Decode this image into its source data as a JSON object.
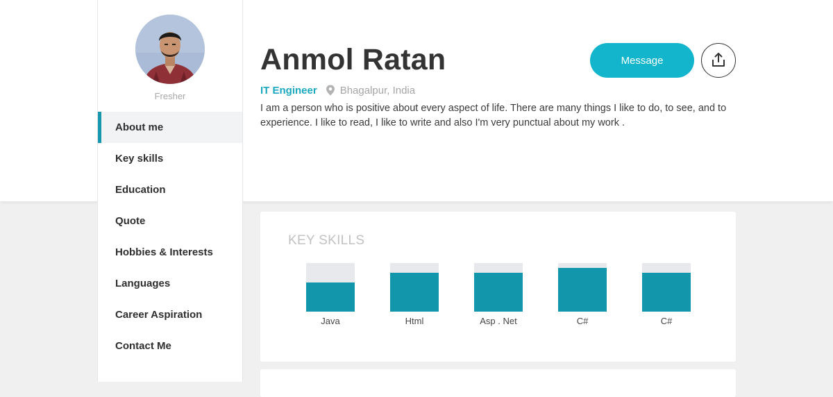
{
  "profile": {
    "role": "Fresher",
    "name": "Anmol Ratan",
    "job_title": "IT Engineer",
    "location": "Bhagalpur, India",
    "bio": "I am a person who is positive about every aspect of life. There are many things I like to do, to see, and to experience. I like to read, I like to write and also I'm very punctual about my work ."
  },
  "actions": {
    "message_label": "Message",
    "share_icon": "share-upload-icon"
  },
  "sidebar": {
    "active_index": 0,
    "items": [
      {
        "label": "About me"
      },
      {
        "label": "Key skills"
      },
      {
        "label": "Education"
      },
      {
        "label": "Quote"
      },
      {
        "label": "Hobbies & Interests"
      },
      {
        "label": "Languages"
      },
      {
        "label": "Career Aspiration"
      },
      {
        "label": "Contact Me"
      }
    ]
  },
  "skills_card": {
    "title": "KEY SKILLS"
  },
  "chart_data": {
    "type": "bar",
    "categories": [
      "Java",
      "Html",
      "Asp . Net",
      "C#",
      "C#"
    ],
    "values": [
      60,
      80,
      80,
      90,
      80
    ],
    "ylim": [
      0,
      100
    ],
    "grid": false
  },
  "colors": {
    "accent": "#12b5cc",
    "bar_fill": "#1196ab",
    "bar_track": "#e8e9ec",
    "job_title": "#1ba9c0",
    "active_menu_border": "#1697ad"
  }
}
